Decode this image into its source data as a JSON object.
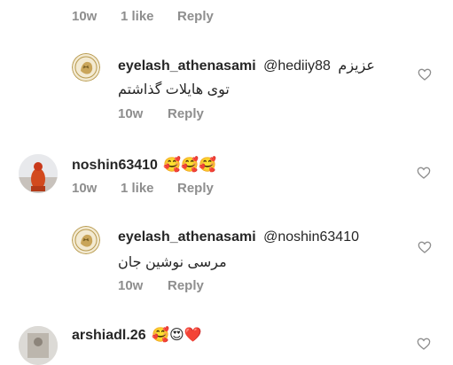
{
  "top_row": {
    "time": "10w",
    "likes": "1 like",
    "reply": "Reply"
  },
  "comments": [
    {
      "username": "eyelash_athenasami",
      "mention": "@hediiy88",
      "text_inline": "عزیزم",
      "text_line2": "توی هایلات گذاشتم",
      "time": "10w",
      "reply": "Reply"
    },
    {
      "username": "noshin63410",
      "emojis": "🥰🥰🥰",
      "time": "10w",
      "likes": "1 like",
      "reply": "Reply"
    },
    {
      "username": "eyelash_athenasami",
      "mention": "@noshin63410",
      "text_line2": "مرسی نوشین جان",
      "time": "10w",
      "reply": "Reply"
    },
    {
      "username": "arshiadl.26",
      "emojis": "🥰😍❤️"
    }
  ],
  "colors": {
    "meta": "#8e8e8e",
    "mention": "#00376b",
    "text": "#262626",
    "heart": "#8e8e8e"
  }
}
